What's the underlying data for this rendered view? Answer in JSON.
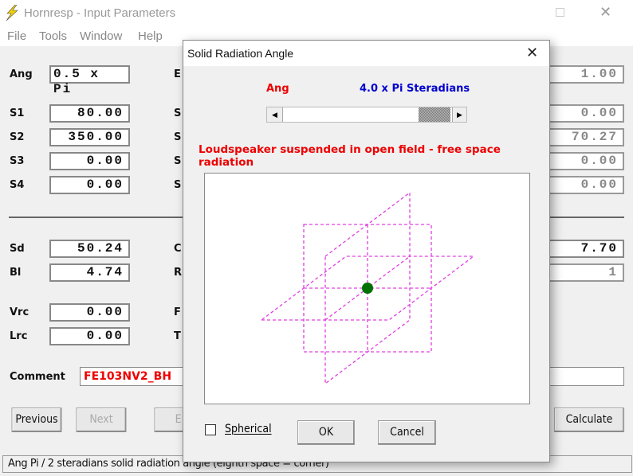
{
  "window": {
    "title": "Hornresp - Input Parameters",
    "icon": "lightning-icon"
  },
  "menu": [
    "File",
    "Tools",
    "Window",
    "Help"
  ],
  "left_fields": [
    {
      "label": "Ang",
      "value": "0.5 x Pi"
    },
    {
      "label": "S1",
      "value": "80.00"
    },
    {
      "label": "S2",
      "value": "350.00"
    },
    {
      "label": "S3",
      "value": "0.00"
    },
    {
      "label": "S4",
      "value": "0.00"
    },
    {
      "label": "Sd",
      "value": "50.24"
    },
    {
      "label": "Bl",
      "value": "4.74"
    },
    {
      "label": "Vrc",
      "value": "0.00"
    },
    {
      "label": "Lrc",
      "value": "0.00"
    }
  ],
  "middle_labels": [
    "E",
    "S",
    "S",
    "S",
    "S",
    "C",
    "R",
    "F",
    "T"
  ],
  "right_fields": [
    {
      "value": "1.00",
      "enabled": false
    },
    {
      "value": "0.00",
      "enabled": false
    },
    {
      "value": "70.27",
      "enabled": false
    },
    {
      "value": "0.00",
      "enabled": false
    },
    {
      "value": "0.00",
      "enabled": false
    },
    {
      "value": "7.70",
      "enabled": true
    },
    {
      "value": "1",
      "enabled": false
    }
  ],
  "comment": {
    "label": "Comment",
    "value": "FE103NV2_BH"
  },
  "buttons": {
    "previous": "Previous",
    "next": "Next",
    "e": "E",
    "calculate": "Calculate"
  },
  "status": "Ang   Pi / 2 steradians solid radiation angle  (eighth space = corner)",
  "dialog": {
    "title": "Solid Radiation Angle",
    "ang_label": "Ang",
    "ang_value": "4.0 x Pi Steradians",
    "slider_fraction": 1.0,
    "description": "Loudspeaker suspended in open field - free space radiation",
    "spherical_label": "Spherical",
    "spherical_checked": false,
    "ok": "OK",
    "cancel": "Cancel",
    "plane_color": "#e040e0",
    "source_color": "#007000"
  }
}
